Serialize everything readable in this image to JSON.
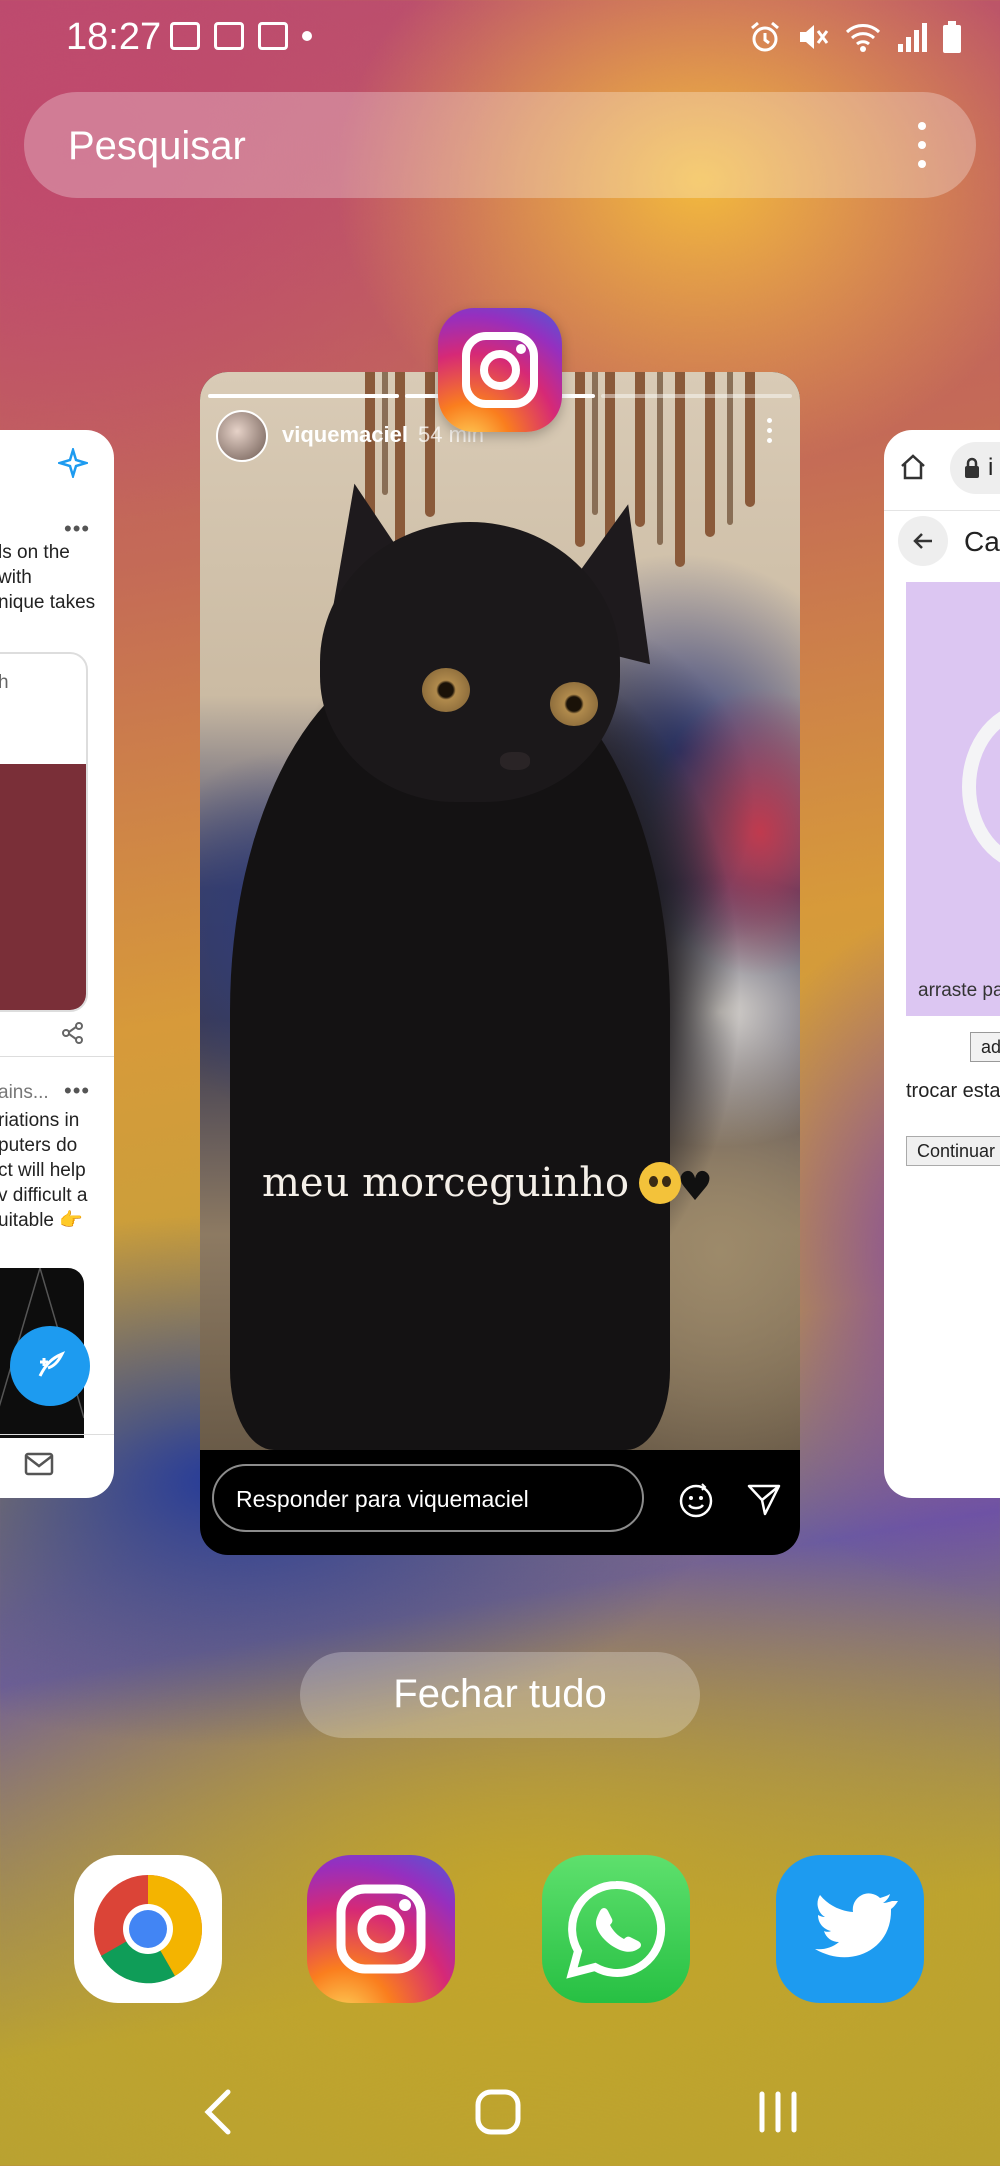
{
  "status_bar": {
    "time": "18:27",
    "left_icons": [
      "gallery-icon",
      "calendar-icon",
      "voicemail-icon",
      "dot-icon"
    ],
    "right_icons": [
      "alarm-icon",
      "mute-icon",
      "wifi-icon",
      "signal-icon",
      "battery-icon"
    ]
  },
  "search": {
    "placeholder": "Pesquisar",
    "menu_icon": "more-vert-icon"
  },
  "recents": {
    "active_app": "Instagram",
    "left_card": {
      "app": "Twitter",
      "lines_top": [
        "ls on the",
        " with",
        "nique takes"
      ],
      "search_hint": "h",
      "tweet2_author": "ains...",
      "tweet2_lines": [
        "riations in",
        "puters do",
        "ct will help",
        "v difficult a",
        "uitable 👉"
      ],
      "accent": "#1d9bf0"
    },
    "main_card": {
      "username": "viquemaciel",
      "time_ago": "54 min",
      "caption": "meu morceguinho",
      "caption_emoji": "🥺🖤",
      "reply_placeholder": "Responder para viquemaciel",
      "progress_segments": 3,
      "progress_current": 2
    },
    "right_card": {
      "app": "Chrome",
      "url_start": "i",
      "page_title_start": "Ca",
      "image_caption": "arraste pa",
      "small_button": "ad",
      "text_line": "trocar esta",
      "continue_button": "Continuar",
      "accent": "#dcc6f2"
    }
  },
  "close_all_label": "Fechar tudo",
  "dock": {
    "apps": [
      "Chrome",
      "Instagram",
      "WhatsApp",
      "Twitter"
    ]
  },
  "nav_bar": {
    "buttons": [
      "back",
      "home",
      "recents"
    ]
  }
}
